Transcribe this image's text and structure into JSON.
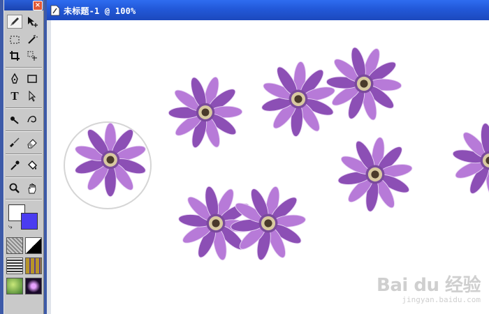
{
  "document": {
    "title": "未标题-1",
    "zoom_separator": "@",
    "zoom": "100%"
  },
  "toolbox": {
    "close_label": "×",
    "tools": [
      {
        "name": "pencil-icon"
      },
      {
        "name": "move-icon"
      },
      {
        "name": "marquee-icon"
      },
      {
        "name": "magic-wand-icon"
      },
      {
        "name": "crop-icon"
      },
      {
        "name": "slice-icon"
      },
      {
        "name": "pen-icon"
      },
      {
        "name": "rectangle-icon"
      },
      {
        "name": "text-icon"
      },
      {
        "name": "selection-arrow-icon"
      },
      {
        "name": "lasso-icon"
      },
      {
        "name": "freeform-icon"
      },
      {
        "name": "brush-icon"
      },
      {
        "name": "eraser-icon"
      },
      {
        "name": "eyedropper-icon"
      },
      {
        "name": "paint-bucket-icon"
      },
      {
        "name": "zoom-icon"
      },
      {
        "name": "hand-icon"
      }
    ],
    "text_tool_glyph": "T",
    "colors": {
      "stroke": "#ffffff",
      "fill": "#4a3cf0"
    },
    "accent": "#1f52d0"
  },
  "watermark": {
    "logo": "Bai du 经验",
    "url": "jingyan.baidu.com"
  },
  "flower_colors": {
    "petal": "#b77ad8",
    "petal_dark": "#8c4fb5",
    "center": "#4a3a2a",
    "stamen": "#d8c9a0"
  }
}
